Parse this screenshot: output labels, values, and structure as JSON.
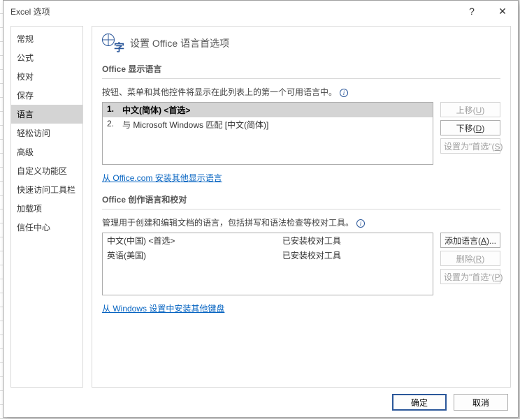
{
  "title": "Excel 选项",
  "sidebar": {
    "items": [
      {
        "label": "常规"
      },
      {
        "label": "公式"
      },
      {
        "label": "校对"
      },
      {
        "label": "保存"
      },
      {
        "label": "语言"
      },
      {
        "label": "轻松访问"
      },
      {
        "label": "高级"
      },
      {
        "label": "自定义功能区"
      },
      {
        "label": "快速访问工具栏"
      },
      {
        "label": "加载项"
      },
      {
        "label": "信任中心"
      }
    ],
    "selected_index": 4
  },
  "heading": "设置 Office 语言首选项",
  "display_section": {
    "title": "Office 显示语言",
    "desc": "按钮、菜单和其他控件将显示在此列表上的第一个可用语言中。",
    "items": [
      {
        "num": "1.",
        "label": "中文(简体) <首选>"
      },
      {
        "num": "2.",
        "label": "与 Microsoft Windows 匹配 [中文(简体)]"
      }
    ],
    "selected_index": 0,
    "buttons": {
      "up": "上移(U)",
      "down": "下移(D)",
      "set_pref": "设置为\"首选\"(S)"
    },
    "link": "从 Office.com 安装其他显示语言"
  },
  "authoring_section": {
    "title": "Office 创作语言和校对",
    "desc": "管理用于创建和编辑文档的语言，包括拼写和语法检查等校对工具。",
    "items": [
      {
        "lang": "中文(中国) <首选>",
        "status": "已安装校对工具"
      },
      {
        "lang": "英语(美国)",
        "status": "已安装校对工具"
      }
    ],
    "buttons": {
      "add": "添加语言(A)...",
      "remove": "删除(R)",
      "set_pref": "设置为\"首选\"(P)"
    },
    "link": "从 Windows 设置中安装其他键盘"
  },
  "footer": {
    "ok": "确定",
    "cancel": "取消"
  }
}
